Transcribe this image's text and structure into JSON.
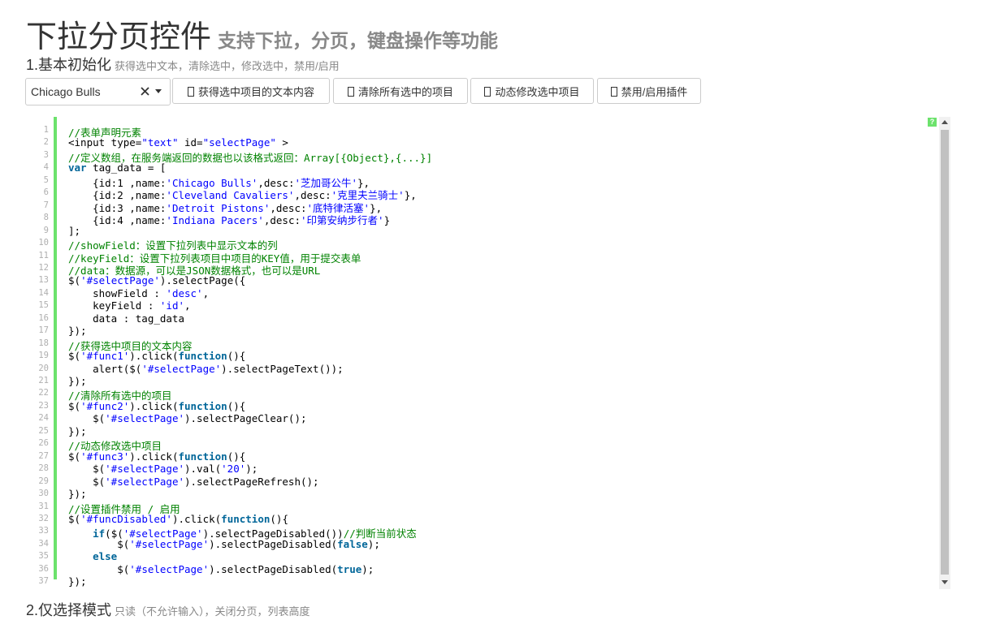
{
  "header": {
    "title": "下拉分页控件",
    "subtitle": "支持下拉，分页，键盘操作等功能"
  },
  "section1": {
    "title": "1.基本初始化",
    "desc": "获得选中文本，清除选中，修改选中，禁用/启用"
  },
  "select": {
    "value": "Chicago Bulls"
  },
  "buttons": {
    "get_text": "获得选中项目的文本内容",
    "clear": "清除所有选中的项目",
    "modify": "动态修改选中项目",
    "disable": "禁用/启用插件"
  },
  "editor": {
    "help_label": "?",
    "line_numbers": [
      "1",
      "2",
      "3",
      "4",
      "5",
      "6",
      "7",
      "8",
      "9",
      "10",
      "11",
      "12",
      "13",
      "14",
      "15",
      "16",
      "17",
      "18",
      "19",
      "20",
      "21",
      "22",
      "23",
      "24",
      "25",
      "26",
      "27",
      "28",
      "29",
      "30",
      "31",
      "32",
      "33",
      "34",
      "35",
      "36",
      "37"
    ],
    "code_lines": [
      "//表单声明元素",
      "<input type=\"text\" id=\"selectPage\" >",
      "//定义数组，在服务端返回的数据也以该格式返回：Array[{Object},{...}]",
      "var tag_data = [",
      "    {id:1 ,name:'Chicago Bulls',desc:'芝加哥公牛'},",
      "    {id:2 ,name:'Cleveland Cavaliers',desc:'克里夫兰骑士'},",
      "    {id:3 ,name:'Detroit Pistons',desc:'底特律活塞'},",
      "    {id:4 ,name:'Indiana Pacers',desc:'印第安纳步行者'}",
      "];",
      "//showField：设置下拉列表中显示文本的列",
      "//keyField：设置下拉列表项目中项目的KEY值，用于提交表单",
      "//data：数据源，可以是JSON数据格式，也可以是URL",
      "$('#selectPage').selectPage({",
      "    showField : 'desc',",
      "    keyField : 'id',",
      "    data : tag_data",
      "});",
      "//获得选中项目的文本内容",
      "$('#func1').click(function(){",
      "    alert($('#selectPage').selectPageText());",
      "});",
      "//清除所有选中的项目",
      "$('#func2').click(function(){",
      "    $('#selectPage').selectPageClear();",
      "});",
      "//动态修改选中项目",
      "$('#func3').click(function(){",
      "    $('#selectPage').val('20');",
      "    $('#selectPage').selectPageRefresh();",
      "});",
      "//设置插件禁用 / 启用",
      "$('#funcDisabled').click(function(){",
      "    if($('#selectPage').selectPageDisabled())//判断当前状态",
      "        $('#selectPage').selectPageDisabled(false);",
      "    else",
      "        $('#selectPage').selectPageDisabled(true);",
      "});"
    ]
  },
  "section2": {
    "title": "2.仅选择模式",
    "desc": "只读（不允许输入），关闭分页，列表高度"
  }
}
